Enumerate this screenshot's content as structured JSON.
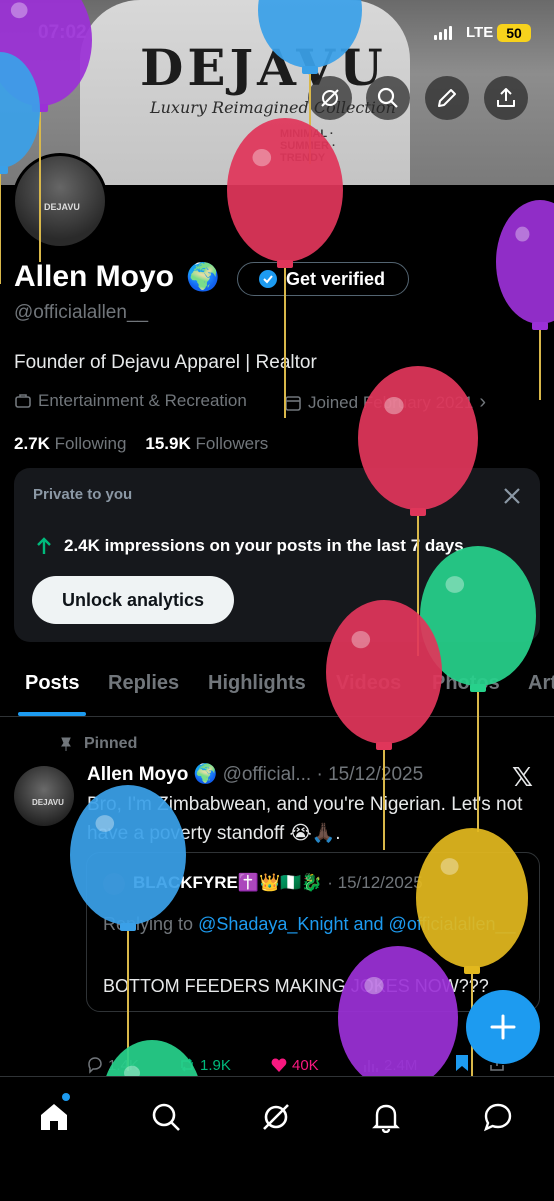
{
  "status_bar": {
    "time": "07:02",
    "network": "LTE",
    "battery": "50"
  },
  "banner": {
    "brand": "DEJAVU",
    "tagline": "Luxury Reimagined Collection",
    "subline": "MINIMAL · SUMMER · TRENDY"
  },
  "header_buttons": [
    "grok-icon",
    "search-icon",
    "edit-icon",
    "share-icon"
  ],
  "profile": {
    "name": "Allen Moyo",
    "name_emoji": "🌍",
    "verify_label": "Get verified",
    "handle": "@officialallen__",
    "bio": "Founder of Dejavu Apparel | Realtor",
    "category": "Entertainment & Recreation",
    "joined": "Joined February 2021",
    "following_count": "2.7K",
    "following_label": "Following",
    "followers_count": "15.9K",
    "followers_label": "Followers"
  },
  "analytics_card": {
    "label": "Private to you",
    "impressions": "2.4K impressions on your posts in the last 7 days",
    "button": "Unlock analytics"
  },
  "tabs": [
    {
      "label": "Posts",
      "active": true
    },
    {
      "label": "Replies",
      "active": false
    },
    {
      "label": "Highlights",
      "active": false
    },
    {
      "label": "Videos",
      "active": false
    },
    {
      "label": "Photos",
      "active": false
    },
    {
      "label": "Art",
      "active": false
    }
  ],
  "post": {
    "pinned_label": "Pinned",
    "author": "Allen Moyo 🌍",
    "handle": "@official...",
    "date": "· 15/12/2025",
    "text": "Bro, I'm Zimbabwean, and you're Nigerian. Let's not have a poverty standoff 😭🙏🏿.",
    "quote": {
      "author": "BLACKFYRE✝️👑🇳🇬🐉",
      "date": "· 15/12/2025",
      "reply_prefix": "Replying to",
      "reply_to_1": "@Shadaya_Knight",
      "reply_and": "and",
      "reply_to_2": "@officialallen__",
      "text": "BOTTOM FEEDERS MAKING JOKES NOW???"
    },
    "replies": "1.4K",
    "reposts": "1.9K",
    "likes": "40K",
    "views": "2.4M"
  },
  "colors": {
    "accent": "#1d9bf0",
    "background": "#000000",
    "card": "#16181c",
    "muted": "#71767b",
    "like": "#f91880",
    "repost": "#00ba7c"
  },
  "balloons": [
    {
      "color": "#9b30d6"
    },
    {
      "color": "#3aa0e8"
    },
    {
      "color": "#e0365a"
    },
    {
      "color": "#9b30d6"
    },
    {
      "color": "#3aa0e8"
    },
    {
      "color": "#e0365a"
    },
    {
      "color": "#27d18b"
    },
    {
      "color": "#e0365a"
    },
    {
      "color": "#e2b81e"
    },
    {
      "color": "#9b30d6"
    },
    {
      "color": "#3aa0e8"
    },
    {
      "color": "#27d18b"
    }
  ]
}
